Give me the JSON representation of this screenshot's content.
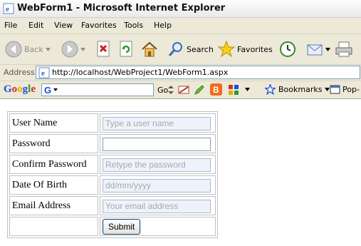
{
  "window": {
    "title": "WebForm1 - Microsoft Internet Explorer"
  },
  "menu": [
    "File",
    "Edit",
    "View",
    "Favorites",
    "Tools",
    "Help"
  ],
  "toolbar": {
    "back": "Back",
    "search": "Search",
    "favorites": "Favorites"
  },
  "address": {
    "label": "Address",
    "url": "http://localhost/WebProject1/WebForm1.aspx"
  },
  "google_toolbar": {
    "logo": "Google",
    "go": "Go",
    "bookmarks": "Bookmarks",
    "popup": "Pop-"
  },
  "form": {
    "rows": [
      {
        "label": "User Name",
        "placeholder": "Type a user name",
        "value": ""
      },
      {
        "label": "Password",
        "placeholder": "",
        "value": ""
      },
      {
        "label": "Confirm Password",
        "placeholder": "Retype the password",
        "value": ""
      },
      {
        "label": "Date Of Birth",
        "placeholder": "dd/mm/yyyy",
        "value": ""
      },
      {
        "label": "Email Address",
        "placeholder": "Your email address",
        "value": ""
      }
    ],
    "submit_label": "Submit"
  },
  "colors": {
    "chrome": "#ece9d8",
    "field_tint": "#eef3fb",
    "field_border": "#a6b8d6"
  }
}
